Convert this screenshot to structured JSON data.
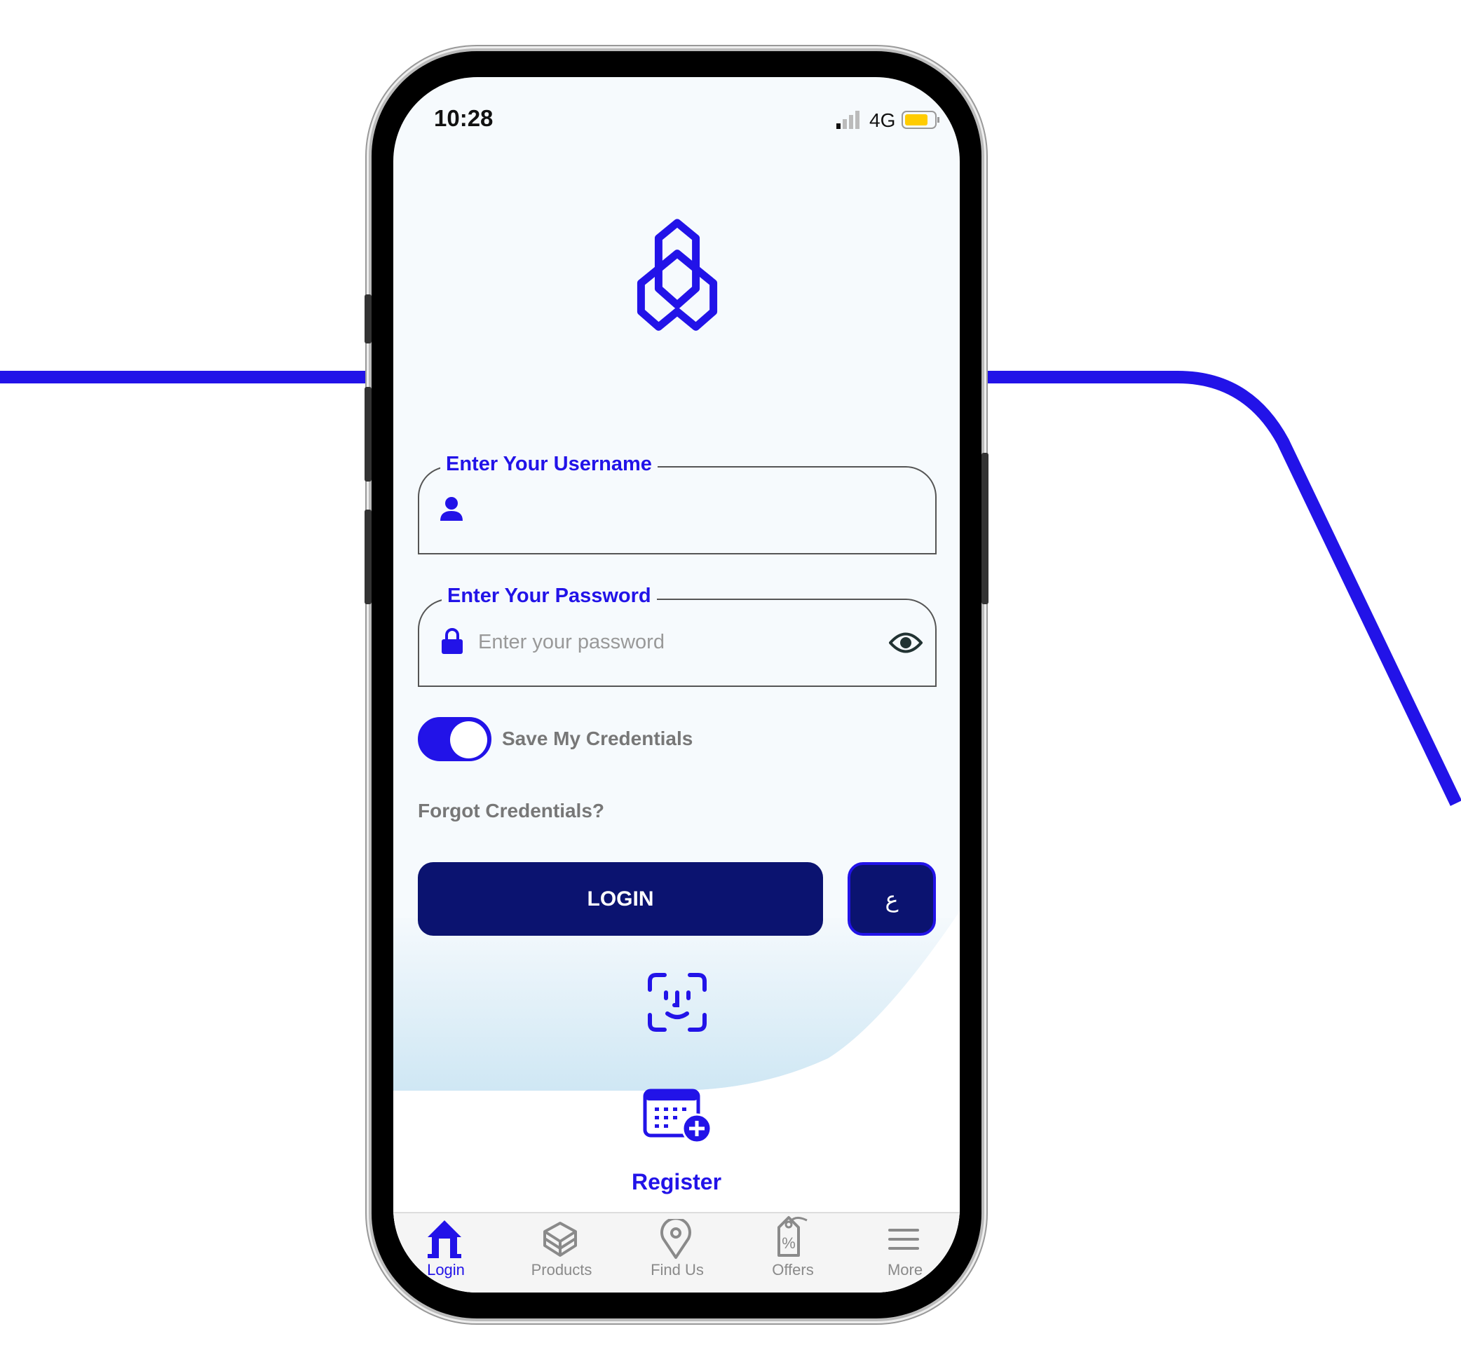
{
  "accent_color": "#2213e8",
  "dark_button_color": "#0b1370",
  "status_bar": {
    "time": "10:28",
    "network": "4G",
    "signal_icon": "cellular-signal-icon",
    "battery_icon": "battery-icon",
    "battery_color": "#ffcc00"
  },
  "logo": {
    "icon": "hexagon-trefoil-logo"
  },
  "username": {
    "label": "Enter Your Username",
    "value": "",
    "icon": "user-icon"
  },
  "password": {
    "label": "Enter Your Password",
    "placeholder": "Enter your password",
    "icon": "lock-icon",
    "toggle_icon": "eye-icon"
  },
  "save_credentials": {
    "label": "Save My Credentials",
    "on": true
  },
  "forgot_label": "Forgot Credentials?",
  "login_label": "LOGIN",
  "language_label": "ع",
  "face_id_icon": "face-id-icon",
  "register": {
    "label": "Register",
    "icon": "calendar-plus-icon"
  },
  "tabs": [
    {
      "label": "Login",
      "icon": "home-icon",
      "active": true
    },
    {
      "label": "Products",
      "icon": "box-icon",
      "active": false
    },
    {
      "label": "Find Us",
      "icon": "location-pin-icon",
      "active": false
    },
    {
      "label": "Offers",
      "icon": "percent-tag-icon",
      "active": false
    },
    {
      "label": "More",
      "icon": "menu-icon",
      "active": false
    }
  ]
}
